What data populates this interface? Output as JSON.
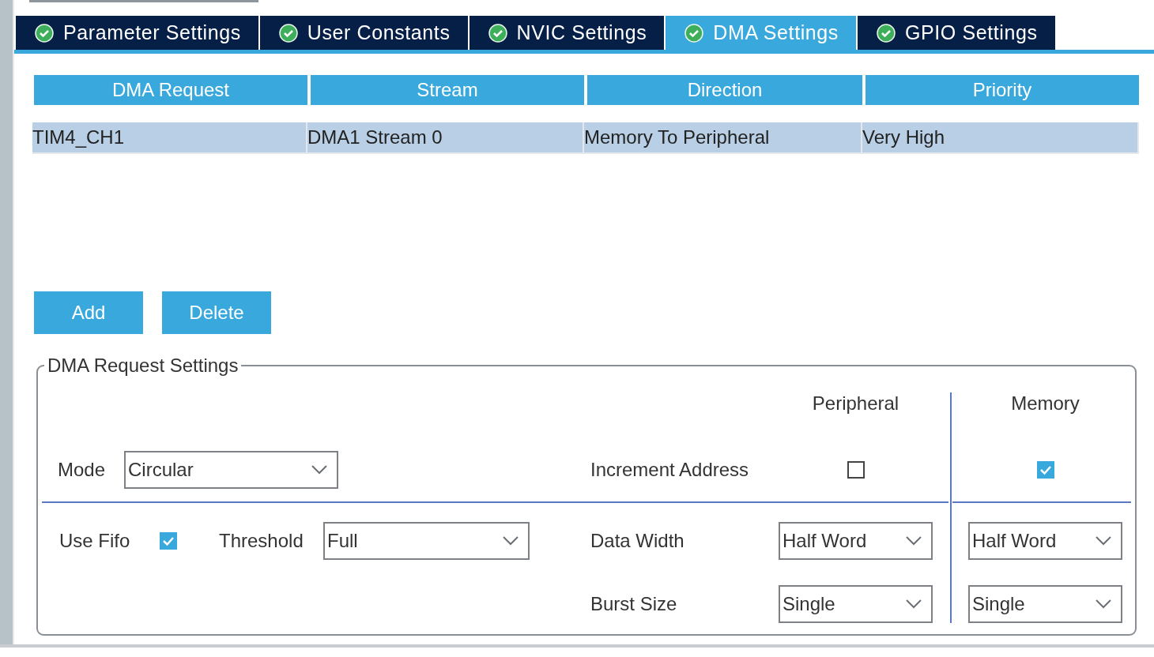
{
  "tabs": [
    {
      "label": "Parameter Settings",
      "selected": false
    },
    {
      "label": "User Constants",
      "selected": false
    },
    {
      "label": "NVIC Settings",
      "selected": false
    },
    {
      "label": "DMA Settings",
      "selected": true
    },
    {
      "label": "GPIO Settings",
      "selected": false
    }
  ],
  "table": {
    "columns": [
      "DMA Request",
      "Stream",
      "Direction",
      "Priority"
    ],
    "rows": [
      {
        "cells": [
          "TIM4_CH1",
          "DMA1 Stream 0",
          "Memory To Peripheral",
          "Very High"
        ],
        "selected": true
      }
    ]
  },
  "buttons": [
    "Add",
    "Delete"
  ],
  "request_settings": {
    "title": "DMA Request Settings",
    "column_headers": [
      "Peripheral",
      "Memory"
    ],
    "mode": {
      "label": "Mode",
      "value": "Circular"
    },
    "use_fifo": {
      "label": "Use Fifo",
      "checked": true
    },
    "threshold": {
      "label": "Threshold",
      "value": "Full"
    },
    "rows": [
      {
        "label": "Increment Address",
        "kind": "checkbox",
        "peripheral": {
          "checked": false
        },
        "memory": {
          "checked": true
        }
      },
      {
        "label": "Data Width",
        "kind": "select",
        "peripheral": {
          "value": "Half Word"
        },
        "memory": {
          "value": "Half Word"
        }
      },
      {
        "label": "Burst Size",
        "kind": "select",
        "peripheral": {
          "value": "Single"
        },
        "memory": {
          "value": "Single"
        }
      }
    ]
  }
}
